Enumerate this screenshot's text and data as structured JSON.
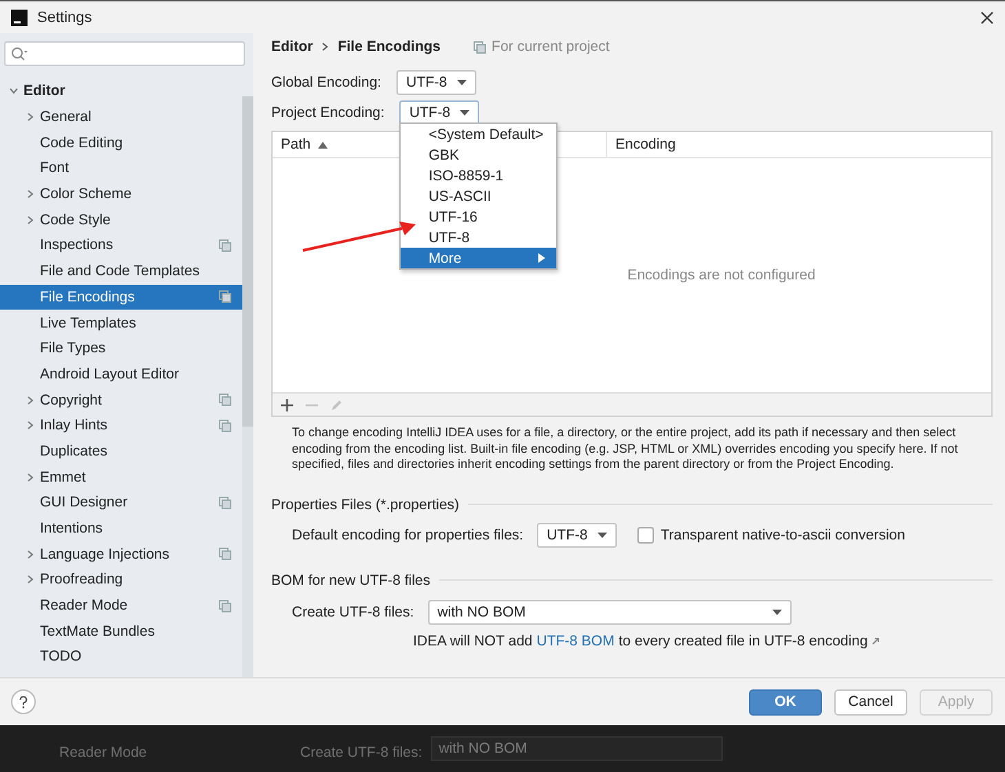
{
  "window": {
    "title": "Settings"
  },
  "sidebar": {
    "items": [
      {
        "label": "Editor",
        "kind": "group",
        "expanded": true,
        "selected": false,
        "project_scope": false,
        "children": [
          {
            "label": "General",
            "kind": "group",
            "expanded": false,
            "selected": false,
            "project_scope": false
          },
          {
            "label": "Code Editing",
            "kind": "leaf",
            "selected": false,
            "project_scope": false
          },
          {
            "label": "Font",
            "kind": "leaf",
            "selected": false,
            "project_scope": false
          },
          {
            "label": "Color Scheme",
            "kind": "group",
            "expanded": false,
            "selected": false,
            "project_scope": false
          },
          {
            "label": "Code Style",
            "kind": "group",
            "expanded": false,
            "selected": false,
            "project_scope": false
          },
          {
            "label": "Inspections",
            "kind": "leaf",
            "selected": false,
            "project_scope": true
          },
          {
            "label": "File and Code Templates",
            "kind": "leaf",
            "selected": false,
            "project_scope": false
          },
          {
            "label": "File Encodings",
            "kind": "leaf",
            "selected": true,
            "project_scope": true
          },
          {
            "label": "Live Templates",
            "kind": "leaf",
            "selected": false,
            "project_scope": false
          },
          {
            "label": "File Types",
            "kind": "leaf",
            "selected": false,
            "project_scope": false
          },
          {
            "label": "Android Layout Editor",
            "kind": "leaf",
            "selected": false,
            "project_scope": false
          },
          {
            "label": "Copyright",
            "kind": "group",
            "expanded": false,
            "selected": false,
            "project_scope": true
          },
          {
            "label": "Inlay Hints",
            "kind": "group",
            "expanded": false,
            "selected": false,
            "project_scope": true
          },
          {
            "label": "Duplicates",
            "kind": "leaf",
            "selected": false,
            "project_scope": false
          },
          {
            "label": "Emmet",
            "kind": "group",
            "expanded": false,
            "selected": false,
            "project_scope": false
          },
          {
            "label": "GUI Designer",
            "kind": "leaf",
            "selected": false,
            "project_scope": true
          },
          {
            "label": "Intentions",
            "kind": "leaf",
            "selected": false,
            "project_scope": false
          },
          {
            "label": "Language Injections",
            "kind": "group",
            "expanded": false,
            "selected": false,
            "project_scope": true
          },
          {
            "label": "Proofreading",
            "kind": "group",
            "expanded": false,
            "selected": false,
            "project_scope": false
          },
          {
            "label": "Reader Mode",
            "kind": "leaf",
            "selected": false,
            "project_scope": true
          },
          {
            "label": "TextMate Bundles",
            "kind": "leaf",
            "selected": false,
            "project_scope": false
          },
          {
            "label": "TODO",
            "kind": "leaf",
            "selected": false,
            "project_scope": false
          }
        ]
      }
    ]
  },
  "breadcrumb": {
    "items": [
      "Editor",
      "File Encodings"
    ],
    "scope": "For current project"
  },
  "encodings": [
    {
      "label": "Global Encoding:",
      "value": "UTF-8",
      "expanded": false
    },
    {
      "label": "Project Encoding:",
      "value": "UTF-8",
      "expanded": true
    }
  ],
  "popup": {
    "items": [
      {
        "label": "<System Default>",
        "selected": false,
        "submenu": false
      },
      {
        "label": "GBK",
        "selected": false,
        "submenu": false
      },
      {
        "label": "ISO-8859-1",
        "selected": false,
        "submenu": false
      },
      {
        "label": "US-ASCII",
        "selected": false,
        "submenu": false
      },
      {
        "label": "UTF-16",
        "selected": false,
        "submenu": false
      },
      {
        "label": "UTF-8",
        "selected": false,
        "submenu": false
      },
      {
        "label": "More",
        "selected": true,
        "submenu": true
      }
    ]
  },
  "table": {
    "columns": [
      {
        "label": "Path",
        "sorted": true
      },
      {
        "label": "Encoding",
        "sorted": false
      }
    ],
    "empty_text": "Encodings are not configured",
    "toolbar": [
      {
        "kind": "add",
        "disabled": false
      },
      {
        "kind": "remove",
        "disabled": true
      },
      {
        "kind": "edit",
        "disabled": true
      }
    ]
  },
  "description": "To change encoding IntelliJ IDEA uses for a file, a directory, or the entire project, add its path if necessary and then select encoding from the encoding list. Built-in file encoding (e.g. JSP, HTML or XML) overrides encoding you specify here. If not specified, files and directories inherit encoding settings from the parent directory or from the Project Encoding.",
  "properties_files": {
    "title": "Properties Files (*.properties)",
    "label": "Default encoding for properties files:",
    "value": "UTF-8",
    "checkbox": {
      "label": "Transparent native-to-ascii conversion",
      "checked": false
    }
  },
  "bom": {
    "title": "BOM for new UTF-8 files",
    "label": "Create UTF-8 files:",
    "value": "with NO BOM",
    "note_before": "IDEA will NOT add",
    "link": "UTF-8 BOM",
    "note_after": "to every created file in UTF-8 encoding"
  },
  "buttons": [
    {
      "label": "OK",
      "kind": "primary",
      "disabled": false
    },
    {
      "label": "Cancel",
      "kind": "default",
      "disabled": false
    },
    {
      "label": "Apply",
      "kind": "default",
      "disabled": true
    }
  ],
  "background_window": {
    "sidebar_item": "Reader Mode",
    "label": "Create UTF-8 files:",
    "value": "with NO BOM"
  }
}
